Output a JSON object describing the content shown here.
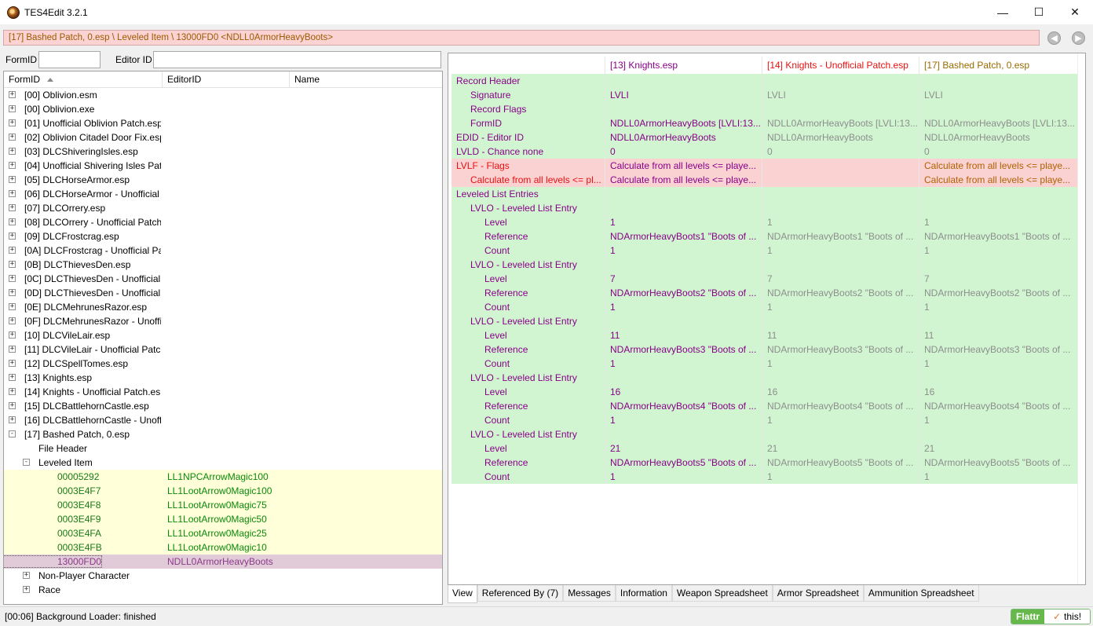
{
  "window": {
    "title": "TES4Edit 3.2.1",
    "minimize": "—",
    "maximize": "☐",
    "close": "✕"
  },
  "path": "[17] Bashed Patch, 0.esp \\ Leveled Item \\ 13000FD0 <NDLL0ArmorHeavyBoots>",
  "nav": {
    "back": "◀",
    "forward": "▶"
  },
  "filters": {
    "formid_label": "FormID",
    "editorid_label": "Editor ID",
    "formid_value": "",
    "editorid_value": ""
  },
  "tree": {
    "headers": [
      "FormID",
      "EditorID",
      "Name"
    ],
    "rows": [
      {
        "col1": "[00] Oblivion.esm",
        "col2": "",
        "indent": 0,
        "expander": "+",
        "style": ""
      },
      {
        "col1": "[00] Oblivion.exe",
        "col2": "",
        "indent": 0,
        "expander": "+",
        "style": ""
      },
      {
        "col1": "[01] Unofficial Oblivion Patch.esp",
        "col2": "",
        "indent": 0,
        "expander": "+",
        "style": ""
      },
      {
        "col1": "[02] Oblivion Citadel Door Fix.esp",
        "col2": "",
        "indent": 0,
        "expander": "+",
        "style": ""
      },
      {
        "col1": "[03] DLCShiveringIsles.esp",
        "col2": "",
        "indent": 0,
        "expander": "+",
        "style": ""
      },
      {
        "col1": "[04] Unofficial Shivering Isles Patch.esp",
        "col2": "",
        "indent": 0,
        "expander": "+",
        "style": ""
      },
      {
        "col1": "[05] DLCHorseArmor.esp",
        "col2": "",
        "indent": 0,
        "expander": "+",
        "style": ""
      },
      {
        "col1": "[06] DLCHorseArmor - Unofficial Patch.esp",
        "col2": "",
        "indent": 0,
        "expander": "+",
        "style": ""
      },
      {
        "col1": "[07] DLCOrrery.esp",
        "col2": "",
        "indent": 0,
        "expander": "+",
        "style": ""
      },
      {
        "col1": "[08] DLCOrrery - Unofficial Patch.esp",
        "col2": "",
        "indent": 0,
        "expander": "+",
        "style": ""
      },
      {
        "col1": "[09] DLCFrostcrag.esp",
        "col2": "",
        "indent": 0,
        "expander": "+",
        "style": ""
      },
      {
        "col1": "[0A] DLCFrostcrag - Unofficial Patch.esp",
        "col2": "",
        "indent": 0,
        "expander": "+",
        "style": ""
      },
      {
        "col1": "[0B] DLCThievesDen.esp",
        "col2": "",
        "indent": 0,
        "expander": "+",
        "style": ""
      },
      {
        "col1": "[0C] DLCThievesDen - Unofficial Patch.esp",
        "col2": "",
        "indent": 0,
        "expander": "+",
        "style": ""
      },
      {
        "col1": "[0D] DLCThievesDen - Unofficial Patch - SSSB.esp",
        "col2": "",
        "indent": 0,
        "expander": "+",
        "style": ""
      },
      {
        "col1": "[0E] DLCMehrunesRazor.esp",
        "col2": "",
        "indent": 0,
        "expander": "+",
        "style": ""
      },
      {
        "col1": "[0F] DLCMehrunesRazor - Unofficial Patch.esp",
        "col2": "",
        "indent": 0,
        "expander": "+",
        "style": ""
      },
      {
        "col1": "[10] DLCVileLair.esp",
        "col2": "",
        "indent": 0,
        "expander": "+",
        "style": ""
      },
      {
        "col1": "[11] DLCVileLair - Unofficial Patch.esp",
        "col2": "",
        "indent": 0,
        "expander": "+",
        "style": ""
      },
      {
        "col1": "[12] DLCSpellTomes.esp",
        "col2": "",
        "indent": 0,
        "expander": "+",
        "style": ""
      },
      {
        "col1": "[13] Knights.esp",
        "col2": "",
        "indent": 0,
        "expander": "+",
        "style": ""
      },
      {
        "col1": "[14] Knights - Unofficial Patch.esp",
        "col2": "",
        "indent": 0,
        "expander": "+",
        "style": ""
      },
      {
        "col1": "[15] DLCBattlehornCastle.esp",
        "col2": "",
        "indent": 0,
        "expander": "+",
        "style": ""
      },
      {
        "col1": "[16] DLCBattlehornCastle - Unofficial Patch.esp",
        "col2": "",
        "indent": 0,
        "expander": "+",
        "style": ""
      },
      {
        "col1": "[17] Bashed Patch, 0.esp",
        "col2": "",
        "indent": 0,
        "expander": "-",
        "style": ""
      },
      {
        "col1": "File Header",
        "col2": "",
        "indent": 1,
        "expander": "",
        "style": ""
      },
      {
        "col1": "Leveled Item",
        "col2": "",
        "indent": 1,
        "expander": "-",
        "style": ""
      },
      {
        "col1": "00005292",
        "col2": "LL1NPCArrowMagic100",
        "indent": 2,
        "expander": "",
        "style": "hl"
      },
      {
        "col1": "0003E4F7",
        "col2": "LL1LootArrow0Magic100",
        "indent": 2,
        "expander": "",
        "style": "hl"
      },
      {
        "col1": "0003E4F8",
        "col2": "LL1LootArrow0Magic75",
        "indent": 2,
        "expander": "",
        "style": "hl"
      },
      {
        "col1": "0003E4F9",
        "col2": "LL1LootArrow0Magic50",
        "indent": 2,
        "expander": "",
        "style": "hl"
      },
      {
        "col1": "0003E4FA",
        "col2": "LL1LootArrow0Magic25",
        "indent": 2,
        "expander": "",
        "style": "hl"
      },
      {
        "col1": "0003E4FB",
        "col2": "LL1LootArrow0Magic10",
        "indent": 2,
        "expander": "",
        "style": "hl"
      },
      {
        "col1": "13000FD0",
        "col2": "NDLL0ArmorHeavyBoots",
        "indent": 2,
        "expander": "",
        "style": "sel"
      },
      {
        "col1": "Non-Player Character",
        "col2": "",
        "indent": 1,
        "expander": "+",
        "style": ""
      },
      {
        "col1": "Race",
        "col2": "",
        "indent": 1,
        "expander": "+",
        "style": ""
      }
    ]
  },
  "record": {
    "columns": [
      "[13] Knights.esp",
      "[14] Knights - Unofficial Patch.esp",
      "[17] Bashed Patch, 0.esp"
    ],
    "rows": [
      {
        "label": "Record Header",
        "indent": 0,
        "bg": "green",
        "labelColor": "purple",
        "v": [
          "",
          "",
          ""
        ]
      },
      {
        "label": "Signature",
        "indent": 1,
        "bg": "green",
        "labelColor": "purple",
        "v": [
          "LVLI",
          "LVLI",
          "LVLI"
        ]
      },
      {
        "label": "Record Flags",
        "indent": 1,
        "bg": "green",
        "labelColor": "purple",
        "v": [
          "",
          "",
          ""
        ]
      },
      {
        "label": "FormID",
        "indent": 1,
        "bg": "green",
        "labelColor": "purple",
        "v": [
          "NDLL0ArmorHeavyBoots [LVLI:13...",
          "NDLL0ArmorHeavyBoots [LVLI:13...",
          "NDLL0ArmorHeavyBoots [LVLI:13..."
        ]
      },
      {
        "label": "EDID - Editor ID",
        "indent": 0,
        "bg": "green",
        "labelColor": "purple",
        "v": [
          "NDLL0ArmorHeavyBoots",
          "NDLL0ArmorHeavyBoots",
          "NDLL0ArmorHeavyBoots"
        ]
      },
      {
        "label": "LVLD - Chance none",
        "indent": 0,
        "bg": "green",
        "labelColor": "purple",
        "v": [
          "0",
          "0",
          "0"
        ]
      },
      {
        "label": "LVLF - Flags",
        "indent": 0,
        "bg": "red",
        "labelColor": "red",
        "v": [
          "Calculate from all levels <= playe...",
          "",
          "Calculate from all levels <= playe..."
        ]
      },
      {
        "label": "Calculate from all levels <= pl...",
        "indent": 1,
        "bg": "red",
        "labelColor": "red",
        "v": [
          "Calculate from all levels <= playe...",
          "",
          "Calculate from all levels <= playe..."
        ]
      },
      {
        "label": "Leveled List Entries",
        "indent": 0,
        "bg": "green",
        "labelColor": "purple",
        "v": [
          "",
          "",
          ""
        ]
      },
      {
        "label": "LVLO - Leveled List Entry",
        "indent": 1,
        "bg": "green",
        "labelColor": "purple",
        "v": [
          "",
          "",
          ""
        ]
      },
      {
        "label": "Level",
        "indent": 2,
        "bg": "green",
        "labelColor": "purple",
        "v": [
          "1",
          "1",
          "1"
        ]
      },
      {
        "label": "Reference",
        "indent": 2,
        "bg": "green",
        "labelColor": "purple",
        "v": [
          "NDArmorHeavyBoots1 \"Boots of ...",
          "NDArmorHeavyBoots1 \"Boots of ...",
          "NDArmorHeavyBoots1 \"Boots of ..."
        ]
      },
      {
        "label": "Count",
        "indent": 2,
        "bg": "green",
        "labelColor": "purple",
        "v": [
          "1",
          "1",
          "1"
        ]
      },
      {
        "label": "LVLO - Leveled List Entry",
        "indent": 1,
        "bg": "green",
        "labelColor": "purple",
        "v": [
          "",
          "",
          ""
        ]
      },
      {
        "label": "Level",
        "indent": 2,
        "bg": "green",
        "labelColor": "purple",
        "v": [
          "7",
          "7",
          "7"
        ]
      },
      {
        "label": "Reference",
        "indent": 2,
        "bg": "green",
        "labelColor": "purple",
        "v": [
          "NDArmorHeavyBoots2 \"Boots of ...",
          "NDArmorHeavyBoots2 \"Boots of ...",
          "NDArmorHeavyBoots2 \"Boots of ..."
        ]
      },
      {
        "label": "Count",
        "indent": 2,
        "bg": "green",
        "labelColor": "purple",
        "v": [
          "1",
          "1",
          "1"
        ]
      },
      {
        "label": "LVLO - Leveled List Entry",
        "indent": 1,
        "bg": "green",
        "labelColor": "purple",
        "v": [
          "",
          "",
          ""
        ]
      },
      {
        "label": "Level",
        "indent": 2,
        "bg": "green",
        "labelColor": "purple",
        "v": [
          "11",
          "11",
          "11"
        ]
      },
      {
        "label": "Reference",
        "indent": 2,
        "bg": "green",
        "labelColor": "purple",
        "v": [
          "NDArmorHeavyBoots3 \"Boots of ...",
          "NDArmorHeavyBoots3 \"Boots of ...",
          "NDArmorHeavyBoots3 \"Boots of ..."
        ]
      },
      {
        "label": "Count",
        "indent": 2,
        "bg": "green",
        "labelColor": "purple",
        "v": [
          "1",
          "1",
          "1"
        ]
      },
      {
        "label": "LVLO - Leveled List Entry",
        "indent": 1,
        "bg": "green",
        "labelColor": "purple",
        "v": [
          "",
          "",
          ""
        ]
      },
      {
        "label": "Level",
        "indent": 2,
        "bg": "green",
        "labelColor": "purple",
        "v": [
          "16",
          "16",
          "16"
        ]
      },
      {
        "label": "Reference",
        "indent": 2,
        "bg": "green",
        "labelColor": "purple",
        "v": [
          "NDArmorHeavyBoots4 \"Boots of ...",
          "NDArmorHeavyBoots4 \"Boots of ...",
          "NDArmorHeavyBoots4 \"Boots of ..."
        ]
      },
      {
        "label": "Count",
        "indent": 2,
        "bg": "green",
        "labelColor": "purple",
        "v": [
          "1",
          "1",
          "1"
        ]
      },
      {
        "label": "LVLO - Leveled List Entry",
        "indent": 1,
        "bg": "green",
        "labelColor": "purple",
        "v": [
          "",
          "",
          ""
        ]
      },
      {
        "label": "Level",
        "indent": 2,
        "bg": "green",
        "labelColor": "purple",
        "v": [
          "21",
          "21",
          "21"
        ]
      },
      {
        "label": "Reference",
        "indent": 2,
        "bg": "green",
        "labelColor": "purple",
        "v": [
          "NDArmorHeavyBoots5 \"Boots of ...",
          "NDArmorHeavyBoots5 \"Boots of ...",
          "NDArmorHeavyBoots5 \"Boots of ..."
        ]
      },
      {
        "label": "Count",
        "indent": 2,
        "bg": "green",
        "labelColor": "purple",
        "v": [
          "1",
          "1",
          "1"
        ]
      }
    ]
  },
  "tabs": [
    "View",
    "Referenced By (7)",
    "Messages",
    "Information",
    "Weapon Spreadsheet",
    "Armor Spreadsheet",
    "Ammunition Spreadsheet"
  ],
  "status": {
    "text": "[00:06] Background Loader: finished",
    "flattr_left": "Flattr",
    "flattr_check": "✓",
    "flattr_right": "this!"
  },
  "colors": {
    "green_row": "#d1f5d1",
    "red_row": "#fbd2d2",
    "highlight_row": "#ffffd9",
    "selected_row": "#e2cbd8",
    "path_bar": "#fcd3d3"
  }
}
